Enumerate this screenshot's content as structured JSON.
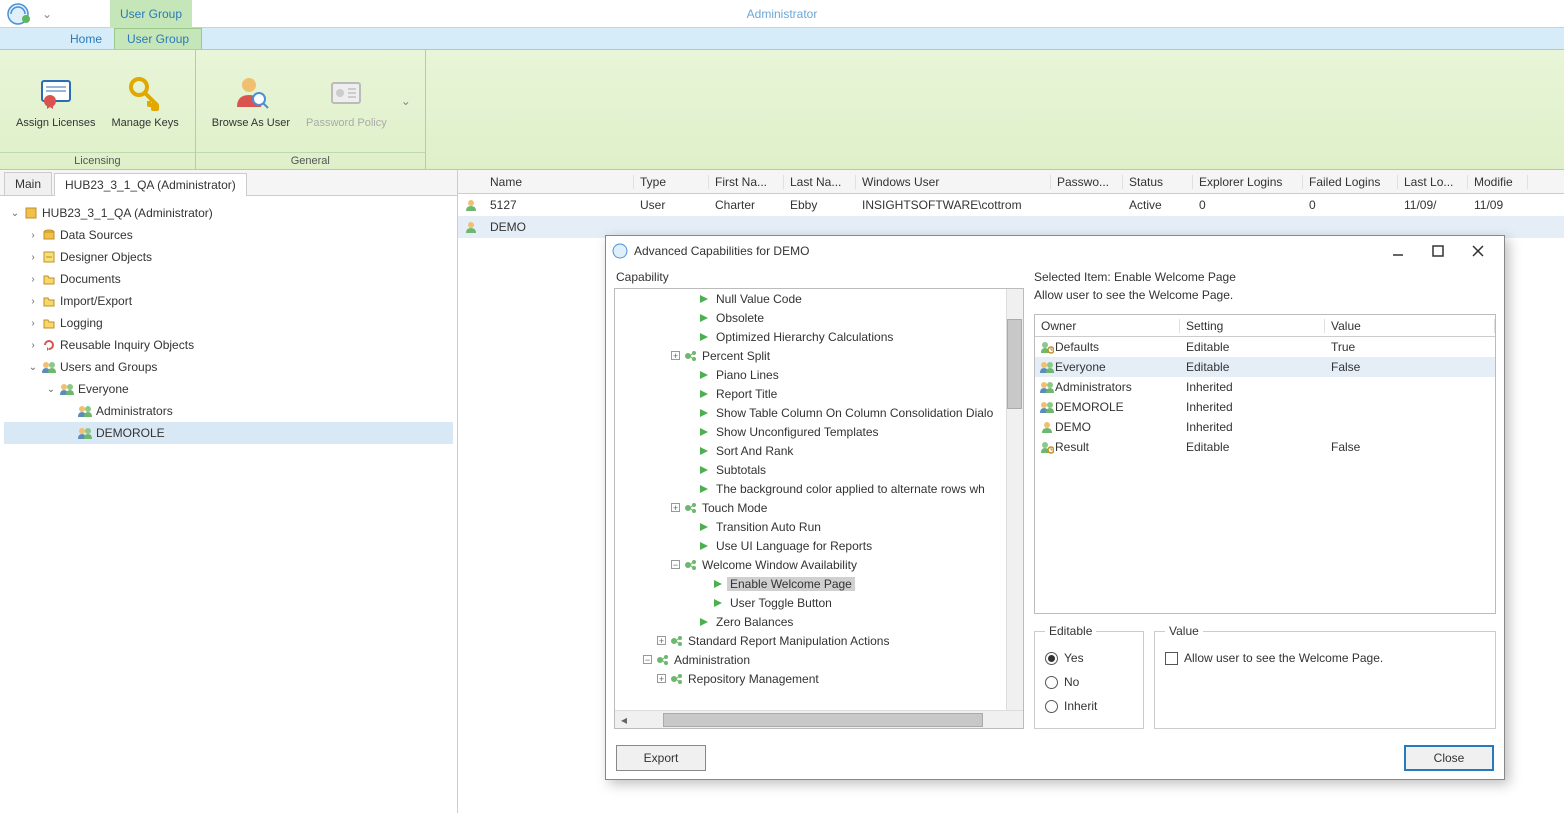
{
  "title": "Administrator",
  "tabs": {
    "context": "User Group",
    "home": "Home",
    "usergroup": "User Group"
  },
  "ribbon": {
    "groups": [
      {
        "label": "Licensing",
        "buttons": [
          {
            "id": "assign-licenses",
            "label": "Assign Licenses"
          },
          {
            "id": "manage-keys",
            "label": "Manage Keys"
          }
        ]
      },
      {
        "label": "General",
        "buttons": [
          {
            "id": "browse-as-user",
            "label": "Browse As User"
          },
          {
            "id": "password-policy",
            "label": "Password Policy",
            "disabled": true
          }
        ]
      }
    ]
  },
  "panel_tabs": {
    "main": "Main",
    "hub": "HUB23_3_1_QA (Administrator)"
  },
  "nav_tree": {
    "root": "HUB23_3_1_QA (Administrator)",
    "items": [
      {
        "label": "Data Sources",
        "icon": "db"
      },
      {
        "label": "Designer Objects",
        "icon": "design"
      },
      {
        "label": "Documents",
        "icon": "folder"
      },
      {
        "label": "Import/Export",
        "icon": "folder"
      },
      {
        "label": "Logging",
        "icon": "folder"
      },
      {
        "label": "Reusable Inquiry Objects",
        "icon": "reuse"
      },
      {
        "label": "Users and Groups",
        "icon": "users",
        "expanded": true,
        "children": [
          {
            "label": "Everyone",
            "icon": "group",
            "expanded": true,
            "children": [
              {
                "label": "Administrators",
                "icon": "group"
              },
              {
                "label": "DEMOROLE",
                "icon": "group",
                "selected": true
              }
            ]
          }
        ]
      }
    ]
  },
  "grid": {
    "headers": [
      "",
      "Name",
      "Type",
      "First Na...",
      "Last Na...",
      "Windows User",
      "Passwo...",
      "Status",
      "Explorer Logins",
      "Failed Logins",
      "Last Lo...",
      "Modifie"
    ],
    "rows": [
      {
        "icon": "user",
        "name": "5127",
        "type": "User",
        "first": "Charter",
        "last": "Ebby",
        "winuser": "INSIGHTSOFTWARE\\cottrom",
        "pass": "",
        "status": "Active",
        "explore": "0",
        "failed": "0",
        "lastlo": "11/09/",
        "modified": "11/09"
      },
      {
        "icon": "user",
        "name": "DEMO",
        "type": "",
        "first": "",
        "last": "",
        "winuser": "",
        "pass": "",
        "status": "",
        "explore": "",
        "failed": "",
        "lastlo": "",
        "modified": "",
        "selected": true
      }
    ]
  },
  "dialog": {
    "title": "Advanced Capabilities for DEMO",
    "capability_label": "Capability",
    "capabilities": [
      {
        "indent": 5,
        "icon": "play",
        "label": "Null Value Code"
      },
      {
        "indent": 5,
        "icon": "play",
        "label": "Obsolete"
      },
      {
        "indent": 5,
        "icon": "play",
        "label": "Optimized Hierarchy Calculations"
      },
      {
        "indent": 4,
        "expand": "+",
        "icon": "node",
        "label": "Percent Split"
      },
      {
        "indent": 5,
        "icon": "play",
        "label": "Piano Lines"
      },
      {
        "indent": 5,
        "icon": "play",
        "label": "Report Title"
      },
      {
        "indent": 5,
        "icon": "play",
        "label": "Show Table Column On Column Consolidation Dialo"
      },
      {
        "indent": 5,
        "icon": "play",
        "label": "Show Unconfigured Templates"
      },
      {
        "indent": 5,
        "icon": "play",
        "label": "Sort And Rank"
      },
      {
        "indent": 5,
        "icon": "play",
        "label": "Subtotals"
      },
      {
        "indent": 5,
        "icon": "play",
        "label": "The background color applied to alternate rows wh"
      },
      {
        "indent": 4,
        "expand": "+",
        "icon": "node",
        "label": "Touch Mode"
      },
      {
        "indent": 5,
        "icon": "play",
        "label": "Transition Auto Run"
      },
      {
        "indent": 5,
        "icon": "play",
        "label": "Use UI Language for Reports"
      },
      {
        "indent": 4,
        "expand": "−",
        "icon": "node",
        "label": "Welcome Window Availability"
      },
      {
        "indent": 6,
        "icon": "play",
        "label": "Enable Welcome Page",
        "selected": true
      },
      {
        "indent": 6,
        "icon": "play",
        "label": "User Toggle Button"
      },
      {
        "indent": 5,
        "icon": "play",
        "label": "Zero Balances"
      },
      {
        "indent": 3,
        "expand": "+",
        "icon": "node",
        "label": "Standard Report Manipulation Actions"
      },
      {
        "indent": 2,
        "expand": "−",
        "icon": "node",
        "label": "Administration"
      },
      {
        "indent": 3,
        "expand": "+",
        "icon": "node",
        "label": "Repository Management"
      }
    ],
    "selected_item_label": "Selected Item: Enable Welcome Page",
    "selected_item_desc": "Allow user to see the Welcome Page.",
    "owner_headers": {
      "owner": "Owner",
      "setting": "Setting",
      "value": "Value"
    },
    "owners": [
      {
        "icon": "defaults",
        "owner": "Defaults",
        "setting": "Editable",
        "value": "True"
      },
      {
        "icon": "group",
        "owner": "Everyone",
        "setting": "Editable",
        "value": "False",
        "selected": true
      },
      {
        "icon": "group",
        "owner": "Administrators",
        "setting": "Inherited",
        "value": ""
      },
      {
        "icon": "group",
        "owner": "DEMOROLE",
        "setting": "Inherited",
        "value": ""
      },
      {
        "icon": "user",
        "owner": "DEMO",
        "setting": "Inherited",
        "value": ""
      },
      {
        "icon": "result",
        "owner": "Result",
        "setting": "Editable",
        "value": "False"
      }
    ],
    "editable_label": "Editable",
    "editable_options": {
      "yes": "Yes",
      "no": "No",
      "inherit": "Inherit"
    },
    "editable_selected": "yes",
    "value_label": "Value",
    "value_checkbox_label": "Allow user to see the Welcome Page.",
    "export_btn": "Export",
    "close_btn": "Close"
  }
}
